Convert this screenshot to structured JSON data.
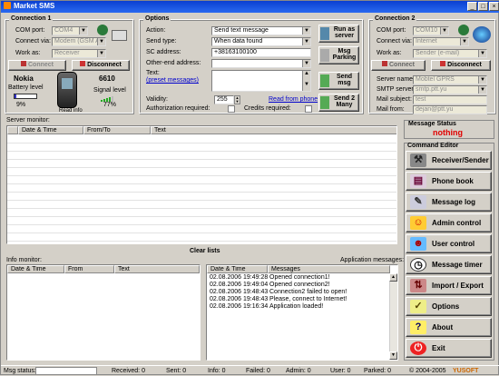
{
  "window": {
    "title": "Market SMS",
    "btn_min": "_",
    "btn_max": "□",
    "btn_close": "×"
  },
  "conn1": {
    "title": "Connection 1",
    "com_label": "COM port:",
    "com_value": "COM4",
    "via_label": "Connect via:",
    "via_value": "Modem (GSM AT)",
    "work_label": "Work as:",
    "work_value": "Receiver",
    "connect": "Connect",
    "disconnect": "Disconnect",
    "phone_brand": "Nokia",
    "phone_model": "6610",
    "battery_label": "Battery level",
    "battery_pct": "9%",
    "battery_level": 0.09,
    "signal_label": "Signal level",
    "signal_pct": "77%",
    "signal_level": 0.77,
    "read_info": "Read info"
  },
  "options": {
    "title": "Options",
    "action_label": "Action:",
    "action_value": "Send text message",
    "sendtype_label": "Send type:",
    "sendtype_value": "When data found",
    "sc_label": "SC address:",
    "sc_value": "+38163100100",
    "other_label": "Other-end address:",
    "text_label": "Text:",
    "preset_link": "(preset messages)",
    "validity_label": "Validity:",
    "validity_value": "255",
    "read_phone": "Read from phone",
    "auth_label": "Authorization required:",
    "credits_label": "Credits required:",
    "run_server": "Run as server",
    "msg_parking": "Msg Parking",
    "send_msg": "Send msg",
    "send_2_many": "Send 2 Many"
  },
  "conn2": {
    "title": "Connection 2",
    "com_label": "COM port:",
    "com_value": "COM10",
    "via_label": "Connect via:",
    "via_value": "Internet",
    "work_label": "Work as:",
    "work_value": "Sender (e-mail)",
    "connect": "Connect",
    "disconnect": "Disconnect",
    "server_label": "Server name:",
    "server_value": "Mobtel GPRS",
    "smtp_label": "SMTP server:",
    "smtp_value": "smtp.ptt.yu",
    "subject_label": "Mail subject:",
    "subject_value": "test",
    "from_label": "Mail from:",
    "from_value": "dejan@ptt.yu"
  },
  "server_monitor": {
    "title": "Server monitor:",
    "cols": [
      "Date & Time",
      "From/To",
      "Text"
    ]
  },
  "message_status": {
    "title": "Message Status",
    "value": "nothing"
  },
  "command_editor": {
    "title": "Command Editor",
    "buttons": [
      "Receiver/Sender",
      "Phone book",
      "Message log",
      "Admin control",
      "User control",
      "Message timer",
      "Import / Export",
      "Options",
      "About",
      "Exit"
    ]
  },
  "clear_lists": "Clear lists",
  "info_monitor": {
    "title": "Info monitor:",
    "cols": [
      "Date & Time",
      "From",
      "Text"
    ]
  },
  "app_messages": {
    "title": "Application messages:",
    "cols": [
      "Date & Time",
      "Messages"
    ],
    "rows": [
      [
        "02.08.2006 19:49:28",
        "Opened connection1!"
      ],
      [
        "02.08.2006 19:49:04",
        "Opened connection2!"
      ],
      [
        "02.08.2006 19:48:43",
        "Connection2 failed to open!"
      ],
      [
        "02.08.2006 19:48:43",
        "Please, connect to Internet!"
      ],
      [
        "02.08.2006 19:16:34",
        "Application loaded!"
      ]
    ]
  },
  "status": {
    "msg_status_label": "Msg status:",
    "received": "Received:  0",
    "sent": "Sent:  0",
    "info": "Info:  0",
    "failed": "Failed:  0",
    "admin": "Admin:  0",
    "user": "User:  0",
    "parked": "Parked:  0",
    "copyright": "© 2004-2005",
    "brand": "YUSOFT"
  },
  "colors": {
    "accent_red": "#e00000",
    "title_blue": "#0a3fd1",
    "link": "#0000cc"
  }
}
